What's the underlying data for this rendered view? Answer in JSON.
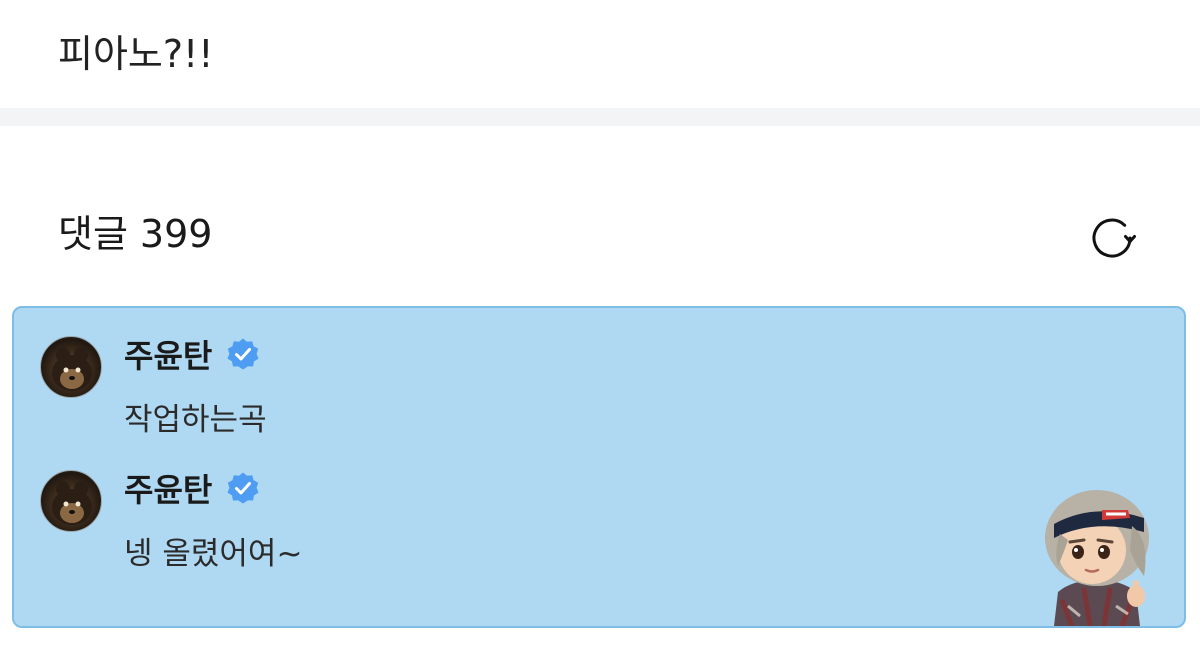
{
  "post": {
    "text": "피아노?!!"
  },
  "comments_section": {
    "title": "댓글",
    "count": "399",
    "refresh_icon": "refresh-icon"
  },
  "comments": [
    {
      "author": "주윤탄",
      "verified_icon": "verified-badge-icon",
      "text": "작업하는곡"
    },
    {
      "author": "주윤탄",
      "verified_icon": "verified-badge-icon",
      "text": "넹 올렸어여~"
    }
  ],
  "colors": {
    "panel_bg": "#afd9f3",
    "panel_border": "#7dbde6",
    "verified_blue": "#4f9df2"
  }
}
